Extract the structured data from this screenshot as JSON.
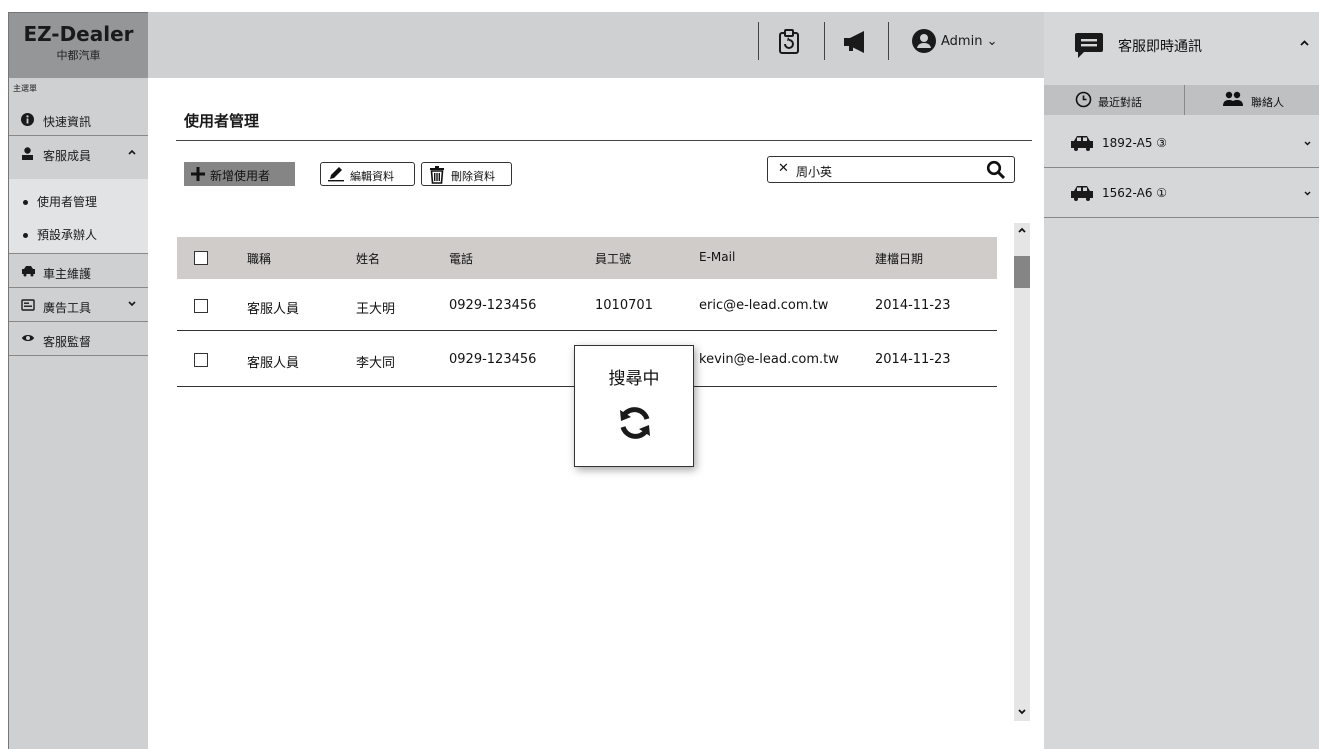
{
  "brand": {
    "title": "EZ-Dealer",
    "subtitle": "中都汽車"
  },
  "header": {
    "user_label": "Admin"
  },
  "sidebar": {
    "caption": "主選單",
    "items": [
      {
        "label": "快速資訊",
        "icon": "info-icon"
      },
      {
        "label": "客服成員",
        "icon": "user-icon",
        "expanded": true
      },
      {
        "label": "車主維護",
        "icon": "car-icon"
      },
      {
        "label": "廣告工具",
        "icon": "billboard-icon",
        "expanded": false
      },
      {
        "label": "客服監督",
        "icon": "eye-icon"
      }
    ],
    "subitems": [
      {
        "label": "使用者管理"
      },
      {
        "label": "預設承辦人"
      }
    ]
  },
  "main": {
    "title": "使用者管理",
    "toolbar": {
      "add_label": "新增使用者",
      "edit_label": "編輯資料",
      "delete_label": "刪除資料"
    },
    "search": {
      "value": "周小英"
    },
    "table": {
      "columns": [
        "職稱",
        "姓名",
        "電話",
        "員工號",
        "E-Mail",
        "建檔日期"
      ],
      "rows": [
        {
          "title": "客服人員",
          "name": "王大明",
          "phone": "0929-123456",
          "employee_id": "1010701",
          "email": "eric@e-lead.com.tw",
          "date": "2014-11-23"
        },
        {
          "title": "客服人員",
          "name": "李大同",
          "phone": "0929-123456",
          "employee_id": "",
          "email": "kevin@e-lead.com.tw",
          "date": "2014-11-23"
        }
      ]
    },
    "loading": {
      "text": "搜尋中"
    }
  },
  "chat": {
    "title": "客服即時通訊",
    "tabs": [
      {
        "label": "最近對話",
        "active": true
      },
      {
        "label": "聯絡人",
        "active": false
      }
    ],
    "conversations": [
      {
        "label": "1892-A5 ③"
      },
      {
        "label": "1562-A6 ①"
      }
    ]
  },
  "colors": {
    "sidebar_bg": "#cfd0d2",
    "header_bg": "#cfd0d2",
    "logo_bg": "#959698",
    "table_header_bg": "#cfccc9",
    "add_button_bg": "#858586"
  }
}
